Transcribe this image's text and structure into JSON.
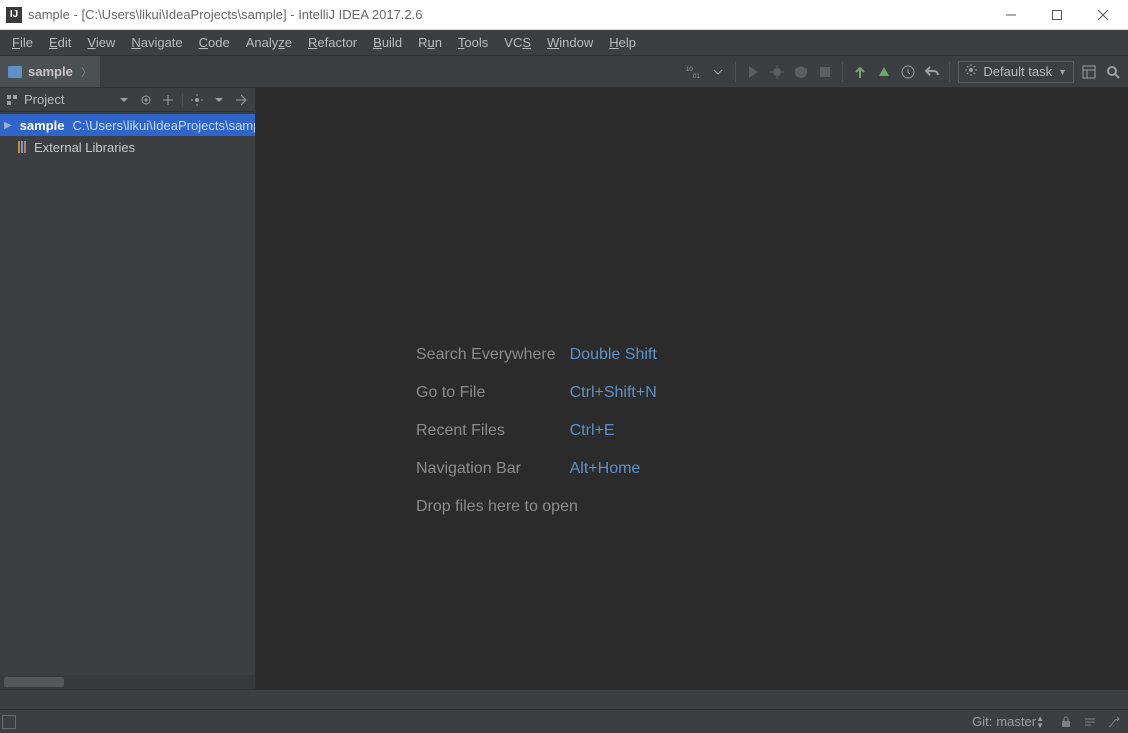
{
  "window": {
    "title": "sample - [C:\\Users\\likui\\IdeaProjects\\sample] - IntelliJ IDEA 2017.2.6"
  },
  "menu": {
    "file": "File",
    "edit": "Edit",
    "view": "View",
    "navigate": "Navigate",
    "code": "Code",
    "analyze": "Analyze",
    "refactor": "Refactor",
    "build": "Build",
    "run": "Run",
    "tools": "Tools",
    "vcs": "VCS",
    "window": "Window",
    "help": "Help"
  },
  "breadcrumb": {
    "root": "sample"
  },
  "toolbar": {
    "default_task": "Default task"
  },
  "project_panel": {
    "title": "Project",
    "root_name": "sample",
    "root_path": "C:\\Users\\likui\\IdeaProjects\\sample",
    "external_libraries": "External Libraries"
  },
  "editor_tips": {
    "search_label": "Search Everywhere",
    "search_key": "Double Shift",
    "goto_label": "Go to File",
    "goto_key": "Ctrl+Shift+N",
    "recent_label": "Recent Files",
    "recent_key": "Ctrl+E",
    "navbar_label": "Navigation Bar",
    "navbar_key": "Alt+Home",
    "drop": "Drop files here to open"
  },
  "status": {
    "git_label": "Git:",
    "git_branch": "master"
  }
}
